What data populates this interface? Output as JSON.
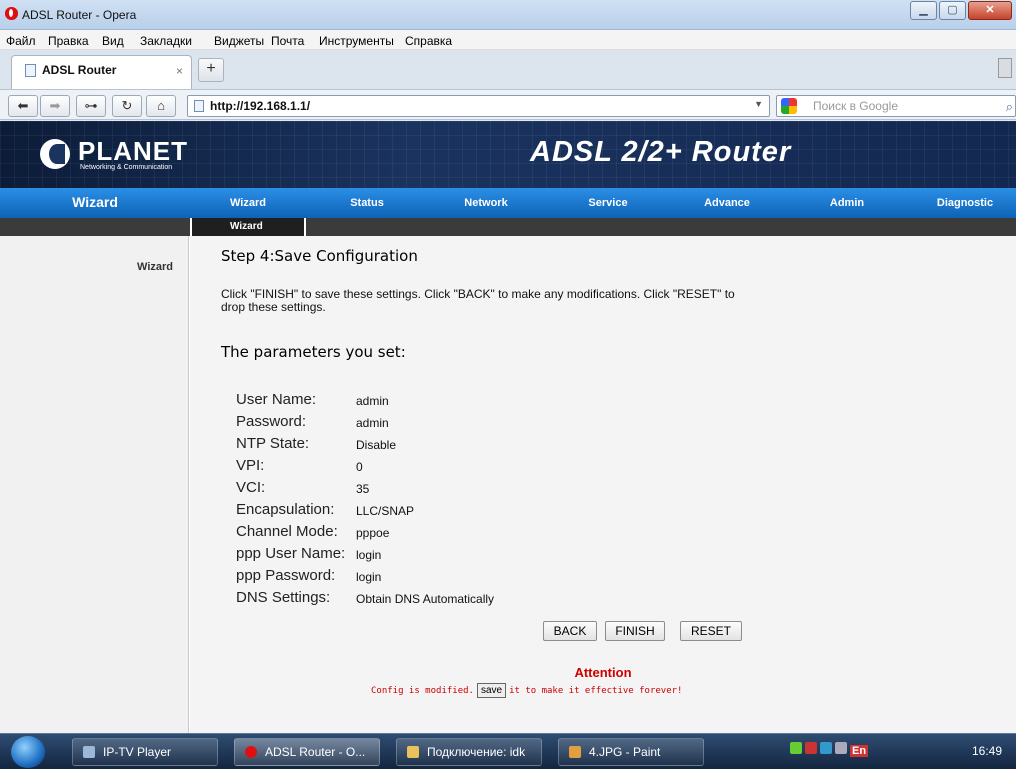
{
  "window": {
    "title": "ADSL Router - Opera"
  },
  "menu": [
    "Файл",
    "Правка",
    "Вид",
    "Закладки",
    "Виджеты",
    "Почта",
    "Инструменты",
    "Справка"
  ],
  "tab": {
    "label": "ADSL Router",
    "close": "×",
    "new_tab": "+"
  },
  "address": {
    "url": "http://192.168.1.1/",
    "search_placeholder": "Поиск в Google"
  },
  "header": {
    "brand": "PLANET",
    "tagline": "Networking & Communication",
    "product": "ADSL 2/2+ Router"
  },
  "nav": {
    "section": "Wizard",
    "items": [
      "Wizard",
      "Status",
      "Network",
      "Service",
      "Advance",
      "Admin",
      "Diagnostic"
    ],
    "subitem": "Wizard"
  },
  "sidebar": {
    "link": "Wizard"
  },
  "content": {
    "step_title": "Step 4:Save Configuration",
    "instructions": "Click \"FINISH\" to save these settings. Click \"BACK\" to make any modifications. Click \"RESET\" to drop these settings.",
    "params_title": "The parameters you set:",
    "params": [
      {
        "label": "User Name:",
        "value": "admin"
      },
      {
        "label": "Password:",
        "value": "admin"
      },
      {
        "label": "NTP State:",
        "value": "Disable"
      },
      {
        "label": "VPI:",
        "value": "0"
      },
      {
        "label": "VCI:",
        "value": "35"
      },
      {
        "label": "Encapsulation:",
        "value": "LLC/SNAP"
      },
      {
        "label": "Channel Mode:",
        "value": "pppoe"
      },
      {
        "label": "ppp User Name:",
        "value": "login"
      },
      {
        "label": "ppp Password:",
        "value": "login"
      },
      {
        "label": "DNS Settings:",
        "value": "Obtain DNS Automatically"
      }
    ],
    "buttons": {
      "back": "BACK",
      "finish": "FINISH",
      "reset": "RESET"
    },
    "attention": "Attention",
    "config_prefix": "Config is modified.",
    "config_save": "save",
    "config_suffix": "it to make it effective forever!"
  },
  "taskbar": {
    "items": [
      "IP-TV Player",
      "ADSL Router - O...",
      "Подключение: idk",
      "4.JPG - Paint"
    ],
    "lang": "En",
    "clock": "16:49"
  },
  "colors": {
    "nav_blue": "#1477d0",
    "attention_red": "#cc0000",
    "header_navy": "#1a335f"
  }
}
